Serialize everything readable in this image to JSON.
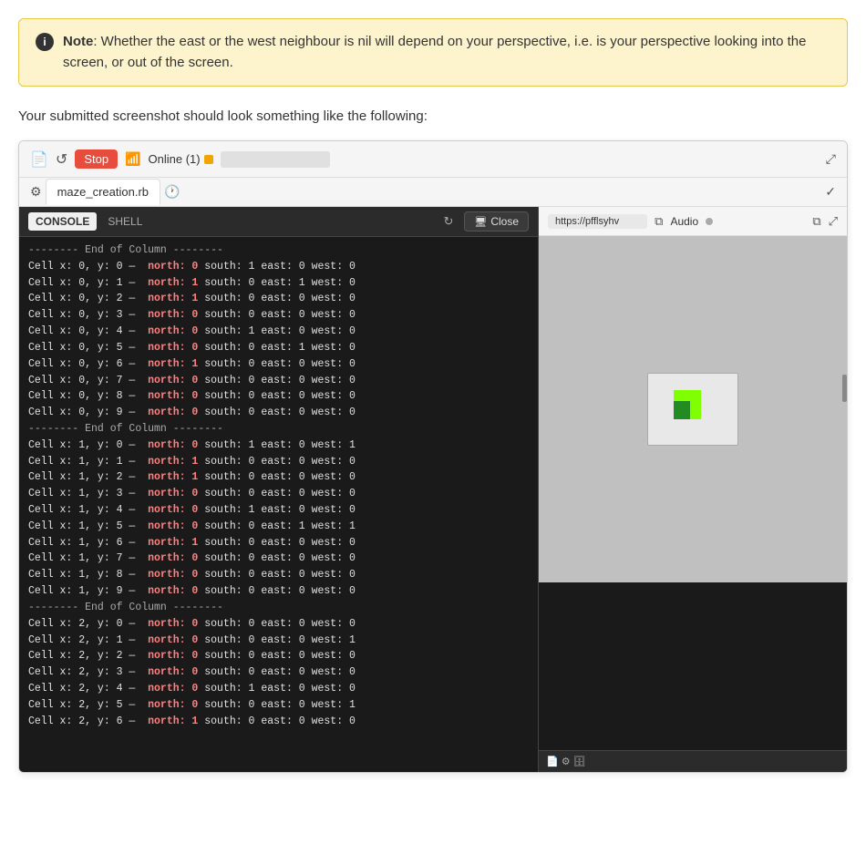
{
  "note": {
    "icon_label": "i",
    "text_bold": "Note",
    "text_body": ": Whether the east or the west neighbour is nil will depend on your perspective, i.e. is your perspective looking into the screen, or out of the screen."
  },
  "subtitle": "Your submitted screenshot should look something like the following:",
  "toolbar": {
    "stop_label": "Stop",
    "online_label": "Online (1)",
    "expand_icon": "⤢",
    "checkmark_icon": "✓"
  },
  "tabs": {
    "file_tab": "maze_creation.rb"
  },
  "console": {
    "tab_console": "CONSOLE",
    "tab_shell": "SHELL",
    "close_label": "Close"
  },
  "preview": {
    "url": "https://pfflsyhv",
    "audio_label": "Audio",
    "open_icon": "⧉",
    "expand_icon": "⤢"
  },
  "console_lines": [
    "-------- End of Column --------",
    "Cell x: 0, y: 0 —  north: 0 south: 1 east: 0 west: 0",
    "Cell x: 0, y: 1 —  north: 1 south: 0 east: 1 west: 0",
    "Cell x: 0, y: 2 —  north: 1 south: 0 east: 0 west: 0",
    "Cell x: 0, y: 3 —  north: 0 south: 0 east: 0 west: 0",
    "Cell x: 0, y: 4 —  north: 0 south: 1 east: 0 west: 0",
    "Cell x: 0, y: 5 —  north: 0 south: 0 east: 1 west: 0",
    "Cell x: 0, y: 6 —  north: 1 south: 0 east: 0 west: 0",
    "Cell x: 0, y: 7 —  north: 0 south: 0 east: 0 west: 0",
    "Cell x: 0, y: 8 —  north: 0 south: 0 east: 0 west: 0",
    "Cell x: 0, y: 9 —  north: 0 south: 0 east: 0 west: 0",
    "-------- End of Column --------",
    "Cell x: 1, y: 0 —  north: 0 south: 1 east: 0 west: 1",
    "Cell x: 1, y: 1 —  north: 1 south: 0 east: 0 west: 0",
    "Cell x: 1, y: 2 —  north: 1 south: 0 east: 0 west: 0",
    "Cell x: 1, y: 3 —  north: 0 south: 0 east: 0 west: 0",
    "Cell x: 1, y: 4 —  north: 0 south: 1 east: 0 west: 0",
    "Cell x: 1, y: 5 —  north: 0 south: 0 east: 1 west: 1",
    "Cell x: 1, y: 6 —  north: 1 south: 0 east: 0 west: 0",
    "Cell x: 1, y: 7 —  north: 0 south: 0 east: 0 west: 0",
    "Cell x: 1, y: 8 —  north: 0 south: 0 east: 0 west: 0",
    "Cell x: 1, y: 9 —  north: 0 south: 0 east: 0 west: 0",
    "-------- End of Column --------",
    "Cell x: 2, y: 0 —  north: 0 south: 0 east: 0 west: 0",
    "Cell x: 2, y: 1 —  north: 0 south: 0 east: 0 west: 1",
    "Cell x: 2, y: 2 —  north: 0 south: 0 east: 0 west: 0",
    "Cell x: 2, y: 3 —  north: 0 south: 0 east: 0 west: 0",
    "Cell x: 2, y: 4 —  north: 0 south: 1 east: 0 west: 0",
    "Cell x: 2, y: 5 —  north: 0 south: 0 east: 0 west: 1",
    "Cell x: 2, y: 6 —  north: 1 south: 0 east: 0 west: 0"
  ]
}
